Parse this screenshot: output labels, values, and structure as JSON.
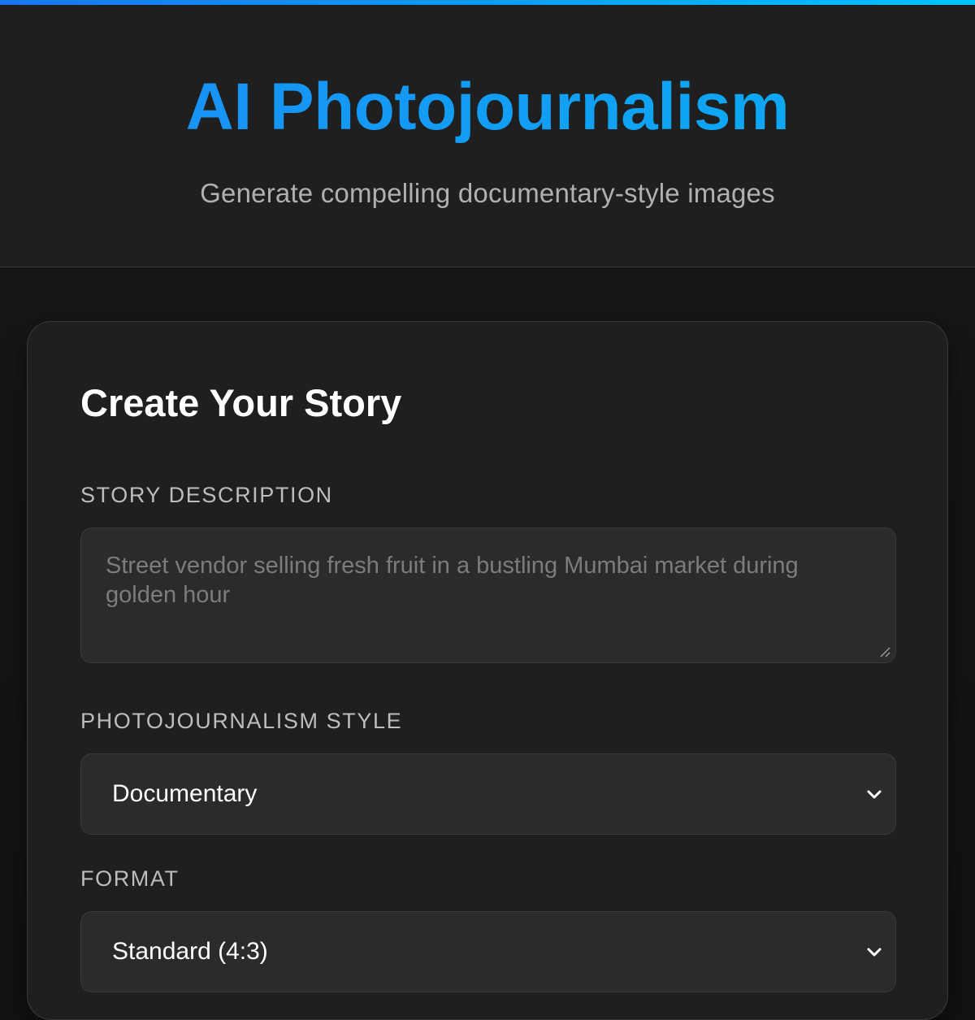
{
  "header": {
    "title": "AI Photojournalism",
    "subtitle": "Generate compelling documentary-style images"
  },
  "form": {
    "title": "Create Your Story",
    "description": {
      "label": "STORY DESCRIPTION",
      "placeholder": "Street vendor selling fresh fruit in a bustling Mumbai market during golden hour"
    },
    "style": {
      "label": "PHOTOJOURNALISM STYLE",
      "selected": "Documentary"
    },
    "format": {
      "label": "FORMAT",
      "selected": "Standard (4:3)"
    }
  },
  "colors": {
    "accent_start": "#1877f2",
    "accent_end": "#00c3ff",
    "background": "#121212",
    "surface": "#1f1f1f",
    "input": "#2b2b2b"
  },
  "icons": {
    "select_chevron": "chevron-down-icon",
    "textarea_resize": "resize-handle-icon"
  }
}
